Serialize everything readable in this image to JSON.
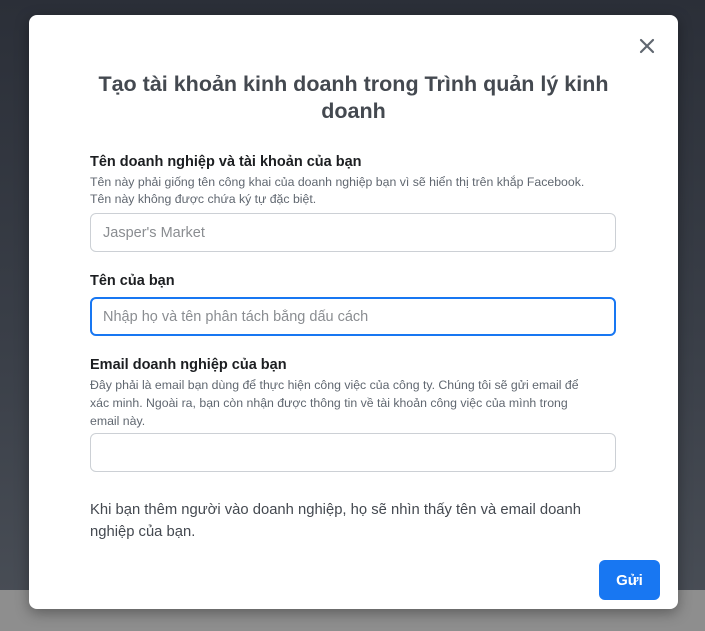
{
  "modal": {
    "title": "Tạo tài khoản kinh doanh trong Trình quản lý kinh doanh",
    "close_icon": "close-icon",
    "business_name": {
      "label": "Tên doanh nghiệp và tài khoản của bạn",
      "help_line1": "Tên này phải giống tên công khai của doanh nghiệp bạn vì sẽ hiển thị trên khắp Facebook.",
      "help_line2": "Tên này không được chứa ký tự đặc biệt.",
      "placeholder": "Jasper's Market",
      "value": ""
    },
    "your_name": {
      "label": "Tên của bạn",
      "placeholder": "Nhập họ và tên phân tách bằng dấu cách",
      "value": ""
    },
    "business_email": {
      "label": "Email doanh nghiệp của bạn",
      "help_line1": "Đây phải là email bạn dùng để thực hiện công việc của công ty. Chúng tôi sẽ gửi email để",
      "help_line2": "xác minh. Ngoài ra, bạn còn nhận được thông tin về tài khoản công việc của mình trong",
      "help_line3": "email này.",
      "placeholder": "",
      "value": ""
    },
    "note": "Khi bạn thêm người vào doanh nghiệp, họ sẽ nhìn thấy tên và email doanh nghiệp của bạn.",
    "submit_label": "Gửi"
  },
  "colors": {
    "accent": "#1877f2",
    "backdrop": "#2b2f38"
  }
}
